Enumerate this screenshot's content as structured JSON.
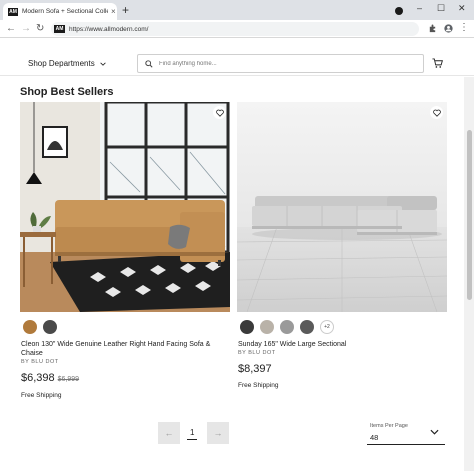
{
  "browser": {
    "tab_title": "Modern Sofa + Sectional Collecti",
    "favicon_text": "AM",
    "close_glyph": "×",
    "newtab_glyph": "+",
    "url": "https://www.allmodern.com/",
    "minimize_glyph": "–",
    "maximize_glyph": "☐",
    "window_close_glyph": "✕",
    "back_glyph": "←",
    "forward_glyph": "→",
    "reload_glyph": "↻",
    "menu_glyph": "⋮"
  },
  "header": {
    "shop_departments": "Shop Departments",
    "search_placeholder": "Find anything home..."
  },
  "section": {
    "title": "Shop Best Sellers"
  },
  "products": [
    {
      "name": "Cleon 130\" Wide Genuine Leather Right Hand Facing Sofa & Chaise",
      "brand": "BY BLU DOT",
      "price": "$6,398",
      "old_price": "$6,999",
      "shipping": "Free Shipping",
      "swatches": [
        "#b07a3c",
        "#4a4a4a"
      ]
    },
    {
      "name": "Sunday 165\" Wide Large Sectional",
      "brand": "BY BLU DOT",
      "price": "$8,397",
      "old_price": "",
      "shipping": "Free Shipping",
      "swatches": [
        "#3a3a3a",
        "#b9b2a8",
        "#9a9a9a",
        "#5a5a5a"
      ],
      "more_swatches": "+2"
    }
  ],
  "pagination": {
    "current_page": "1",
    "prev_glyph": "←",
    "next_glyph": "→"
  },
  "items_per_page": {
    "label": "Items Per Page",
    "value": "48"
  },
  "colors": {
    "accent": "#1a1a1a",
    "leather": "#c9975a",
    "sectional": "#c8c8c8"
  }
}
